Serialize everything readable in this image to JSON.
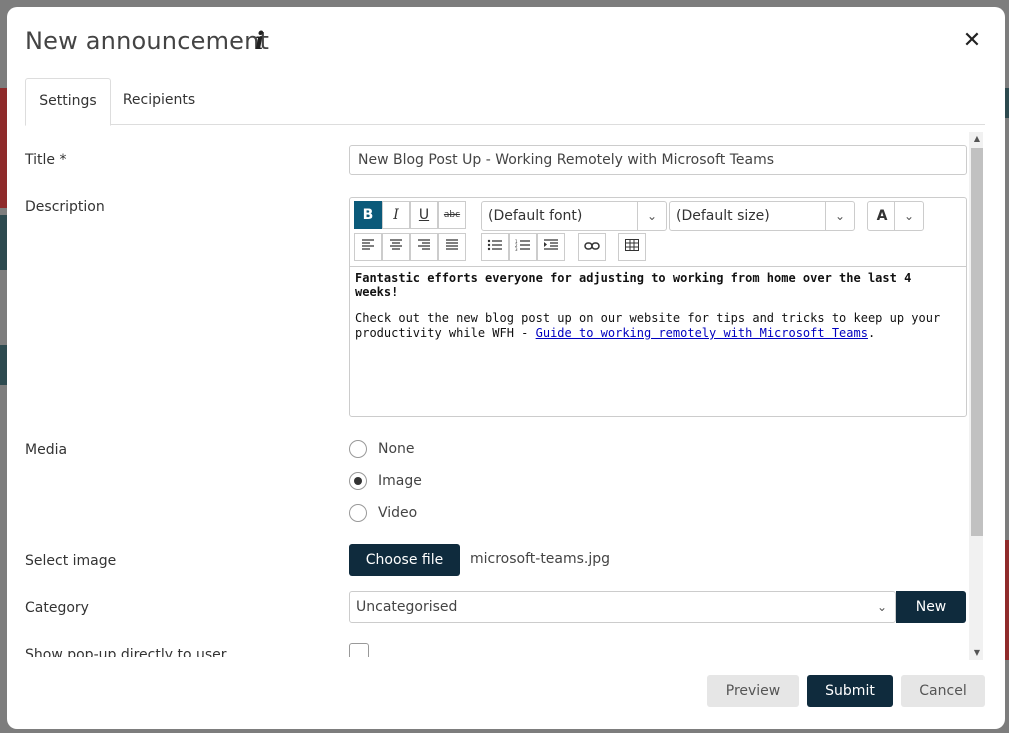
{
  "dialog": {
    "title": "New announcement",
    "info_icon": "info-icon",
    "close_icon": "close-icon"
  },
  "tabs": [
    {
      "label": "Settings",
      "active": true
    },
    {
      "label": "Recipients",
      "active": false
    }
  ],
  "form": {
    "title_label": "Title *",
    "title_value": "New Blog Post Up - Working Remotely with Microsoft Teams",
    "description_label": "Description",
    "editor": {
      "font_select": "(Default font)",
      "size_select": "(Default size)",
      "color_button": "A",
      "bold": "B",
      "italic": "I",
      "underline": "U",
      "strike": "abc",
      "heading_line": "Fantastic efforts everyone for adjusting to working from home over the last 4 weeks!",
      "body_text": "Check out the new blog post up on our website for tips and tricks to keep up your productivity while WFH - ",
      "link_text": "Guide to working remotely with Microsoft Teams",
      "link_trailer": "."
    },
    "media_label": "Media",
    "media_options": [
      {
        "label": "None",
        "checked": false
      },
      {
        "label": "Image",
        "checked": true
      },
      {
        "label": "Video",
        "checked": false
      }
    ],
    "select_image_label": "Select image",
    "choose_file_label": "Choose file",
    "file_name": "microsoft-teams.jpg",
    "category_label": "Category",
    "category_value": "Uncategorised",
    "new_category_label": "New",
    "popup_label": "Show pop-up directly to user"
  },
  "footer": {
    "preview_label": "Preview",
    "submit_label": "Submit",
    "cancel_label": "Cancel"
  },
  "colors": {
    "primary_dark": "#0f2b3d",
    "bold_active": "#0b5a7a"
  }
}
